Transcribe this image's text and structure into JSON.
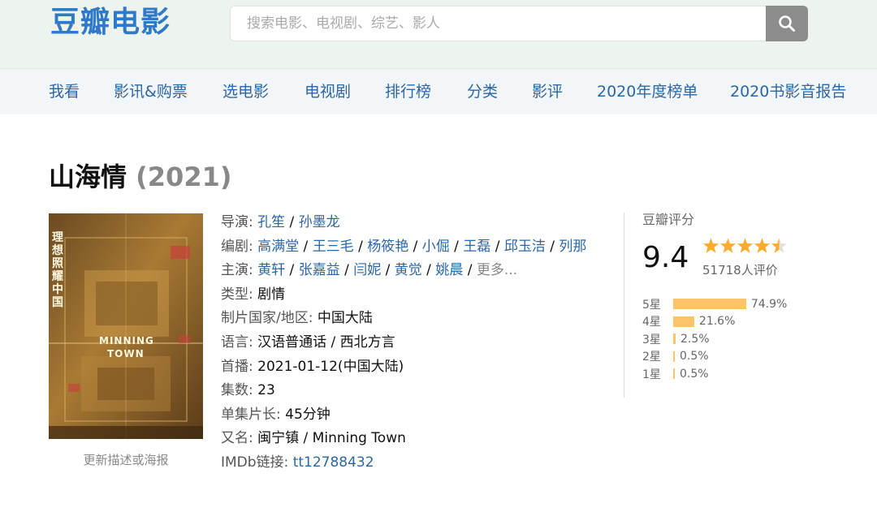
{
  "header": {
    "logo": "豆瓣电影",
    "search_placeholder": "搜索电影、电视剧、综艺、影人"
  },
  "nav": {
    "items": [
      "我看",
      "影讯&购票",
      "选电影",
      "电视剧",
      "排行榜",
      "分类",
      "影评",
      "2020年度榜单",
      "2020书影音报告"
    ]
  },
  "movie": {
    "title": "山海情",
    "year": "(2021)",
    "poster_caption": "更新描述或海报",
    "poster_text": {
      "vertical": "理想照耀中国",
      "en1": "MINNING",
      "en2": "TOWN"
    },
    "info": {
      "director_label": "导演:",
      "directors": [
        "孔笙",
        "孙墨龙"
      ],
      "writer_label": "编剧:",
      "writers": [
        "高满堂",
        "王三毛",
        "杨筱艳",
        "小倔",
        "王磊",
        "邱玉洁",
        "列那"
      ],
      "cast_label": "主演:",
      "cast": [
        "黄轩",
        "张嘉益",
        "闫妮",
        "黄觉",
        "姚晨"
      ],
      "cast_more": "更多...",
      "genre_label": "类型:",
      "genre": "剧情",
      "country_label": "制片国家/地区:",
      "country": "中国大陆",
      "language_label": "语言:",
      "language": "汉语普通话 / 西北方言",
      "premiere_label": "首播:",
      "premiere": "2021-01-12(中国大陆)",
      "episodes_label": "集数:",
      "episodes": "23",
      "runtime_label": "单集片长:",
      "runtime": "45分钟",
      "aka_label": "又名:",
      "aka": "闽宁镇 / Minning Town",
      "imdb_label": "IMDb链接:",
      "imdb": "tt12788432"
    }
  },
  "rating": {
    "label": "豆瓣评分",
    "score": "9.4",
    "stars": 4.5,
    "votes": "51718人评价",
    "star_color": "#ffac2d",
    "bar_color": "#ffc46a",
    "breakdown": [
      {
        "label": "5星",
        "pct": "74.9%",
        "value": 74.9
      },
      {
        "label": "4星",
        "pct": "21.6%",
        "value": 21.6
      },
      {
        "label": "3星",
        "pct": "2.5%",
        "value": 2.5
      },
      {
        "label": "2星",
        "pct": "0.5%",
        "value": 0.5
      },
      {
        "label": "1星",
        "pct": "0.5%",
        "value": 0.5
      }
    ]
  }
}
